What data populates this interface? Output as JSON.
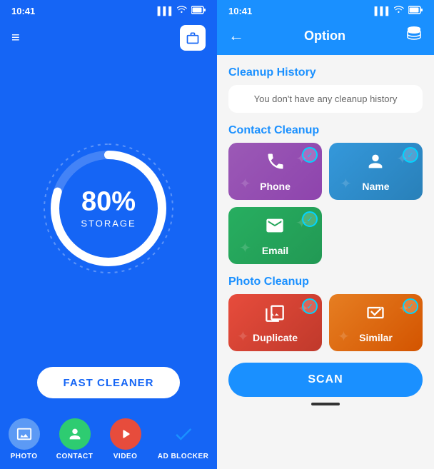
{
  "left": {
    "status_time": "10:41",
    "header_icon": "≡",
    "storage_percent": "80%",
    "storage_label": "STORAGE",
    "fast_cleaner_label": "FAST CLEANER",
    "nav": [
      {
        "id": "photo",
        "label": "PHOTO",
        "icon": "🖼",
        "color": "nav-photo"
      },
      {
        "id": "contact",
        "label": "CONTACT",
        "icon": "👤",
        "color": "nav-contact"
      },
      {
        "id": "video",
        "label": "VIDEO",
        "icon": "▶",
        "color": "nav-video"
      },
      {
        "id": "adblocker",
        "label": "AD BLOCKER",
        "icon": "✔",
        "color": ""
      }
    ]
  },
  "right": {
    "status_time": "10:41",
    "header_title": "Option",
    "cleanup_history_title": "Cleanup History",
    "cleanup_history_empty": "You don't have any cleanup history",
    "contact_cleanup_title": "Contact Cleanup",
    "contact_cards": [
      {
        "id": "phone",
        "label": "Phone",
        "icon": "📞",
        "class": "card-phone"
      },
      {
        "id": "name",
        "label": "Name",
        "icon": "👤",
        "class": "card-name"
      },
      {
        "id": "email",
        "label": "Email",
        "icon": "✉",
        "class": "card-email"
      }
    ],
    "photo_cleanup_title": "Photo Cleanup",
    "photo_cards": [
      {
        "id": "duplicate",
        "label": "Duplicate",
        "icon": "🖼",
        "class": "card-duplicate"
      },
      {
        "id": "similar",
        "label": "Similar",
        "icon": "📷",
        "class": "card-similar"
      }
    ],
    "scan_label": "SCAN"
  }
}
